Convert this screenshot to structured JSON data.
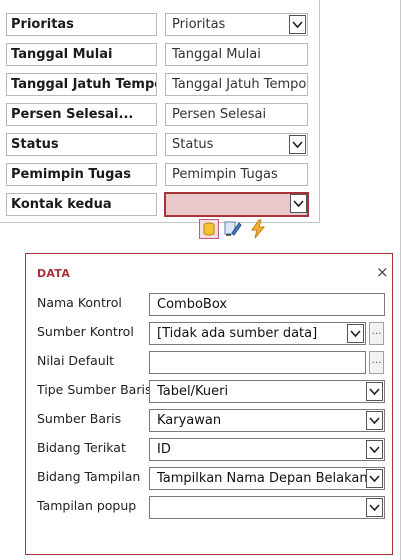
{
  "form": {
    "rows": [
      {
        "label": "Prioritas",
        "value": "Prioritas",
        "dropdown": true,
        "selected": false
      },
      {
        "label": "Tanggal Mulai",
        "value": "Tanggal Mulai",
        "dropdown": false,
        "selected": false
      },
      {
        "label": "Tanggal Jatuh Tempo",
        "value": "Tanggal Jatuh Tempo",
        "dropdown": false,
        "selected": false
      },
      {
        "label": "Persen Selesai...",
        "value": "Persen Selesai",
        "dropdown": false,
        "selected": false
      },
      {
        "label": "Status",
        "value": "Status",
        "dropdown": true,
        "selected": false
      },
      {
        "label": "Pemimpin Tugas",
        "value": "Pemimpin Tugas",
        "dropdown": false,
        "selected": false
      },
      {
        "label": "Kontak kedua",
        "value": "",
        "dropdown": true,
        "selected": true
      }
    ]
  },
  "toolbar_icons": [
    "data-icon",
    "formatting-icon",
    "actions-icon"
  ],
  "panel": {
    "title": "DATA",
    "close_label": "×",
    "fields": [
      {
        "label": "Nama Kontrol",
        "value": "ComboBox",
        "type": "text",
        "builder": false
      },
      {
        "label": "Sumber Kontrol",
        "value": "[Tidak ada sumber data]",
        "type": "dropdown",
        "builder": true
      },
      {
        "label": "Nilai Default",
        "value": "",
        "type": "text",
        "builder": true
      },
      {
        "label": "Tipe Sumber Baris",
        "value": "Tabel/Kueri",
        "type": "dropdown",
        "builder": false
      },
      {
        "label": "Sumber Baris",
        "value": "Karyawan",
        "type": "dropdown",
        "builder": false
      },
      {
        "label": "Bidang Terikat",
        "value": "ID",
        "type": "dropdown",
        "builder": false
      },
      {
        "label": "Bidang Tampilan",
        "value": "Tampilkan Nama Depan Belakang",
        "type": "dropdown",
        "builder": false
      },
      {
        "label": "Tampilan popup",
        "value": "",
        "type": "dropdown",
        "builder": false
      }
    ],
    "builder_label": "..."
  },
  "colors": {
    "accent": "#a9323a",
    "selected_fill": "#e9c8c9",
    "border": "#b9b9b9"
  }
}
